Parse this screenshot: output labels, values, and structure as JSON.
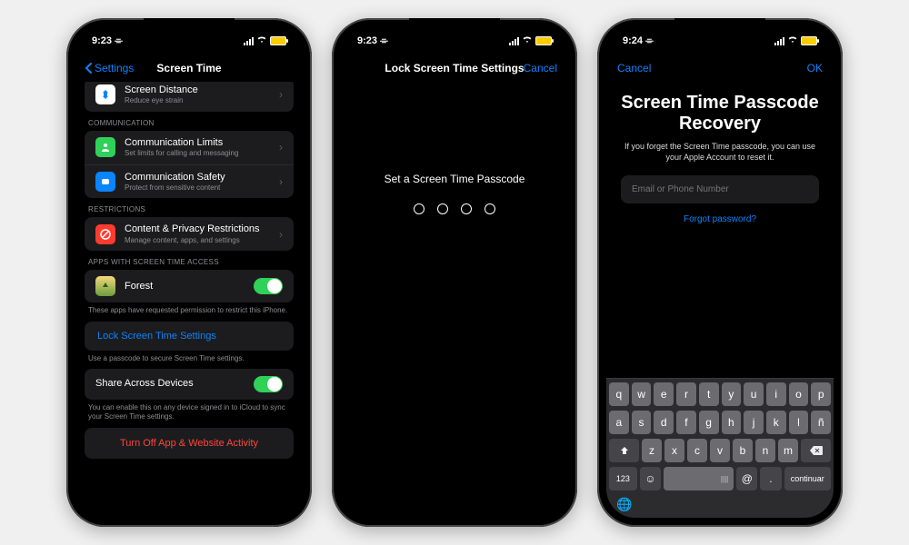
{
  "status": {
    "time1": "9:23",
    "time2": "9:23",
    "time3": "9:24",
    "battery": "80"
  },
  "screen1": {
    "back": "Settings",
    "title": "Screen Time",
    "row_distance_title": "Screen Distance",
    "row_distance_sub": "Reduce eye strain",
    "sec_comm": "COMMUNICATION",
    "row_limits_title": "Communication Limits",
    "row_limits_sub": "Set limits for calling and messaging",
    "row_safety_title": "Communication Safety",
    "row_safety_sub": "Protect from sensitive content",
    "sec_restrict": "RESTRICTIONS",
    "row_content_title": "Content & Privacy Restrictions",
    "row_content_sub": "Manage content, apps, and settings",
    "sec_apps": "APPS WITH SCREEN TIME ACCESS",
    "row_forest": "Forest",
    "apps_footer": "These apps have requested permission to restrict this iPhone.",
    "lock_link": "Lock Screen Time Settings",
    "lock_footer": "Use a passcode to secure Screen Time settings.",
    "row_share": "Share Across Devices",
    "share_footer": "You can enable this on any device signed in to iCloud to sync your Screen Time settings.",
    "turn_off": "Turn Off App & Website Activity"
  },
  "screen2": {
    "title": "Lock Screen Time Settings",
    "cancel": "Cancel",
    "prompt": "Set a Screen Time Passcode"
  },
  "screen3": {
    "cancel": "Cancel",
    "ok": "OK",
    "heading": "Screen Time Passcode Recovery",
    "sub": "If you forget the Screen Time passcode, you can use your Apple Account to reset it.",
    "placeholder": "Email or Phone Number",
    "forgot": "Forgot password?",
    "key_continue": "continuar",
    "key_123": "123",
    "key_at": "@",
    "key_dot": "."
  },
  "keyboard": {
    "r1": [
      "q",
      "w",
      "e",
      "r",
      "t",
      "y",
      "u",
      "i",
      "o",
      "p"
    ],
    "r2": [
      "a",
      "s",
      "d",
      "f",
      "g",
      "h",
      "j",
      "k",
      "l",
      "ñ"
    ],
    "r3": [
      "z",
      "x",
      "c",
      "v",
      "b",
      "n",
      "m"
    ]
  }
}
